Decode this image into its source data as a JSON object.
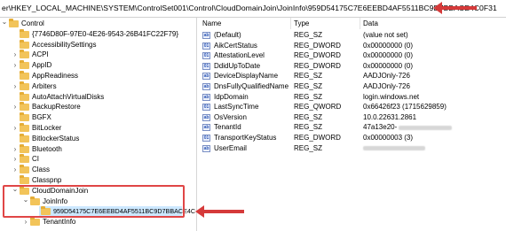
{
  "address_path": "er\\HKEY_LOCAL_MACHINE\\SYSTEM\\ControlSet001\\Control\\CloudDomainJoin\\JoinInfo\\959D54175C7E6EEBD4AF5511BC9D7BBACE4C0F31",
  "tree": [
    {
      "label": "Control",
      "chevron": "v"
    },
    {
      "label": "{7746D80F-97E0-4E26-9543-26B41FC22F79}",
      "chevron": ""
    },
    {
      "label": "AccessibilitySettings",
      "chevron": ""
    },
    {
      "label": "ACPI",
      "chevron": ">"
    },
    {
      "label": "AppID",
      "chevron": ">"
    },
    {
      "label": "AppReadiness",
      "chevron": ""
    },
    {
      "label": "Arbiters",
      "chevron": ">"
    },
    {
      "label": "AutoAttachVirtualDisks",
      "chevron": ""
    },
    {
      "label": "BackupRestore",
      "chevron": ">"
    },
    {
      "label": "BGFX",
      "chevron": ""
    },
    {
      "label": "BitLocker",
      "chevron": ">"
    },
    {
      "label": "BitlockerStatus",
      "chevron": ""
    },
    {
      "label": "Bluetooth",
      "chevron": ">"
    },
    {
      "label": "CI",
      "chevron": ">"
    },
    {
      "label": "Class",
      "chevron": ">"
    },
    {
      "label": "Classpnp",
      "chevron": ""
    },
    {
      "label": "CloudDomainJoin",
      "chevron": "v"
    },
    {
      "label": "JoinInfo",
      "chevron": "v"
    },
    {
      "label": "959D54175C7E6EEBD4AF5511BC9D7BBACE4C",
      "chevron": ""
    },
    {
      "label": "TenantInfo",
      "chevron": ">"
    }
  ],
  "columns": {
    "name": "Name",
    "type": "Type",
    "data": "Data"
  },
  "values": [
    {
      "icon": "ab",
      "name": "(Default)",
      "type": "REG_SZ",
      "data": "(value not set)"
    },
    {
      "icon": "01",
      "name": "AikCertStatus",
      "type": "REG_DWORD",
      "data": "0x00000000 (0)"
    },
    {
      "icon": "01",
      "name": "AttestationLevel",
      "type": "REG_DWORD",
      "data": "0x00000000 (0)"
    },
    {
      "icon": "01",
      "name": "DdidUpToDate",
      "type": "REG_DWORD",
      "data": "0x00000000 (0)"
    },
    {
      "icon": "ab",
      "name": "DeviceDisplayName",
      "type": "REG_SZ",
      "data": "AADJOnly-726"
    },
    {
      "icon": "ab",
      "name": "DnsFullyQualifiedName",
      "type": "REG_SZ",
      "data": "AADJOnly-726"
    },
    {
      "icon": "ab",
      "name": "IdpDomain",
      "type": "REG_SZ",
      "data": "login.windows.net"
    },
    {
      "icon": "01",
      "name": "LastSyncTime",
      "type": "REG_QWORD",
      "data": "0x66426f23 (1715629859)"
    },
    {
      "icon": "ab",
      "name": "OsVersion",
      "type": "REG_SZ",
      "data": "10.0.22631.2861"
    },
    {
      "icon": "ab",
      "name": "TenantId",
      "type": "REG_SZ",
      "data": "47a13e20-"
    },
    {
      "icon": "01",
      "name": "TransportKeyStatus",
      "type": "REG_DWORD",
      "data": "0x00000003 (3)"
    },
    {
      "icon": "ab",
      "name": "UserEmail",
      "type": "REG_SZ",
      "data": ""
    }
  ],
  "colors": {
    "highlight": "#e04646",
    "selection": "#cce8ff",
    "folder": "#f2c45a"
  }
}
